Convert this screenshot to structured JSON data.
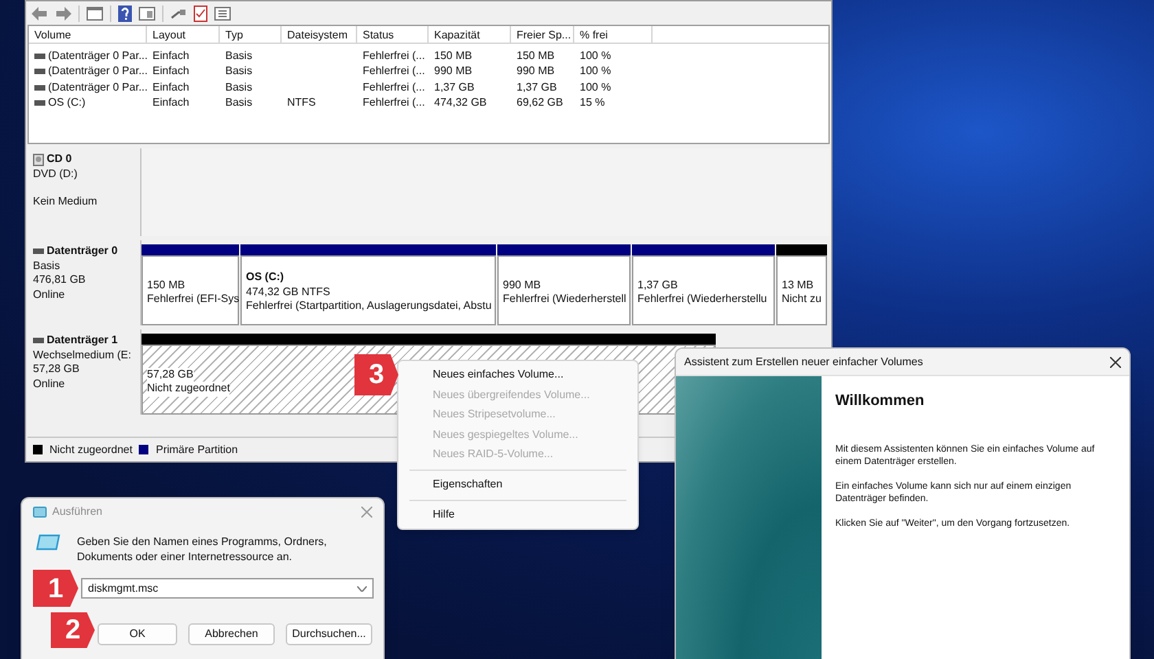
{
  "disk_management": {
    "table": {
      "columns": [
        "Volume",
        "Layout",
        "Typ",
        "Dateisystem",
        "Status",
        "Kapazität",
        "Freier Sp...",
        "% frei"
      ],
      "rows": [
        {
          "cells": [
            "(Datenträger 0 Par...",
            "Einfach",
            "Basis",
            "",
            "Fehlerfrei (...",
            "150 MB",
            "150 MB",
            "100 %"
          ]
        },
        {
          "cells": [
            "(Datenträger 0 Par...",
            "Einfach",
            "Basis",
            "",
            "Fehlerfrei (...",
            "990 MB",
            "990 MB",
            "100 %"
          ]
        },
        {
          "cells": [
            "(Datenträger 0 Par...",
            "Einfach",
            "Basis",
            "",
            "Fehlerfrei (...",
            "1,37 GB",
            "1,37 GB",
            "100 %"
          ]
        },
        {
          "cells": [
            "OS (C:)",
            "Einfach",
            "Basis",
            "NTFS",
            "Fehlerfrei (...",
            "474,32 GB",
            "69,62 GB",
            "15 %"
          ]
        }
      ]
    },
    "disks": [
      {
        "kind": "cd",
        "name": "CD 0",
        "type": "DVD (D:)",
        "status": "Kein Medium"
      },
      {
        "kind": "disk",
        "name": "Datenträger 0",
        "type": "Basis",
        "size": "476,81 GB",
        "status": "Online",
        "partitions": [
          {
            "color": "#000080",
            "size": "150 MB",
            "status": "Fehlerfrei (EFI-Sys"
          },
          {
            "color": "#000080",
            "label": "OS  (C:)",
            "size": "474,32 GB NTFS",
            "status": "Fehlerfrei (Startpartition, Auslagerungsdatei, Abstu"
          },
          {
            "color": "#000080",
            "size": "990 MB",
            "status": "Fehlerfrei (Wiederherstell"
          },
          {
            "color": "#000080",
            "size": "1,37 GB",
            "status": "Fehlerfrei (Wiederherstellu"
          },
          {
            "color": "#000000",
            "size": "13 MB",
            "status": "Nicht zu"
          }
        ]
      },
      {
        "kind": "disk",
        "name": "Datenträger 1",
        "type": "Wechselmedium (E:",
        "size": "57,28 GB",
        "status": "Online",
        "partitions": [
          {
            "color": "#000000",
            "hatched": true,
            "size": "57,28 GB",
            "status": "Nicht zugeordnet"
          }
        ]
      }
    ],
    "legend": [
      {
        "label": "Nicht zugeordnet",
        "color": "#000000"
      },
      {
        "label": "Primäre Partition",
        "color": "#000080"
      }
    ]
  },
  "context_menu": {
    "step_badge": "3",
    "groups": [
      [
        {
          "label": "Neues einfaches Volume...",
          "disabled": false
        },
        {
          "label": "Neues übergreifendes Volume...",
          "disabled": true
        },
        {
          "label": "Neues Stripesetvolume...",
          "disabled": true
        },
        {
          "label": "Neues gespiegeltes Volume...",
          "disabled": true
        },
        {
          "label": "Neues RAID-5-Volume...",
          "disabled": true
        }
      ],
      [
        {
          "label": "Eigenschaften",
          "disabled": false
        }
      ],
      [
        {
          "label": "Hilfe",
          "disabled": false
        }
      ]
    ]
  },
  "run_dialog": {
    "title": "Ausführen",
    "prompt": "Geben Sie den Namen eines Programms, Ordners, Dokuments oder einer Internetressource an.",
    "field": {
      "value": "diskmgmt.msc",
      "step_badge": "1"
    },
    "buttons": [
      {
        "label": "OK",
        "step_badge": "2"
      },
      {
        "label": "Abbrechen"
      },
      {
        "label": "Durchsuchen..."
      }
    ]
  },
  "wizard": {
    "title": "Assistent zum Erstellen neuer einfacher Volumes",
    "heading": "Willkommen",
    "paragraphs": [
      "Mit diesem Assistenten können Sie ein einfaches Volume auf einem Datenträger erstellen.",
      "Ein einfaches Volume kann sich nur auf einem einzigen Datenträger befinden.",
      "Klicken Sie auf \"Weiter\", um den Vorgang fortzusetzen."
    ]
  }
}
